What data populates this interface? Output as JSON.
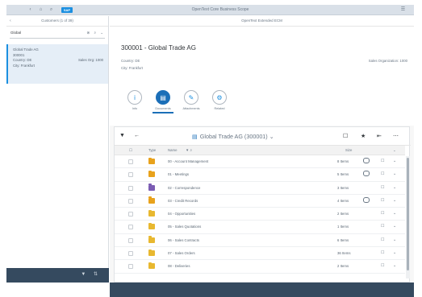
{
  "shell": {
    "title": "OpenText Core Business Scope",
    "logo": "SAP",
    "icons": [
      "back-icon",
      "home-icon",
      "search-icon",
      "user-icon"
    ]
  },
  "master": {
    "header": "Customers (1 of 39)",
    "search_value": "Global",
    "selected_item": {
      "line1": "Global Trade AG",
      "line2": "300001",
      "line3": "Country: DE",
      "line3_right": "Sales Org: 1000",
      "line4": "City: Frankfurt"
    },
    "footer_icons": [
      "filter-icon",
      "sort-icon"
    ]
  },
  "detail": {
    "header": "OpenText Extended ECM",
    "object_title": "300001 - Global Trade AG",
    "attr_country": "Country: DE",
    "attr_city": "City: Frankfurt",
    "attr_sales_org": "Sales Organization: 1000",
    "tabs": [
      {
        "label": "Info",
        "icon": "info-icon",
        "glyph": "i",
        "selected": false
      },
      {
        "label": "Documents",
        "icon": "folder-icon",
        "glyph": "▤",
        "selected": true
      },
      {
        "label": "Attachments",
        "icon": "paperclip-icon",
        "glyph": "✎",
        "selected": false
      },
      {
        "label": "Related",
        "icon": "gear-icon",
        "glyph": "⚙",
        "selected": false
      }
    ],
    "breadcrumb": "Global Trade AG (300001)",
    "columns": {
      "type": "Type",
      "name": "Name",
      "size": "Size"
    },
    "rows": [
      {
        "name": "00 - Account Management",
        "size": "8 Items",
        "color": "#e8a21c",
        "comment": true
      },
      {
        "name": "01 - Meetings",
        "size": "5 Items",
        "color": "#e8a21c",
        "comment": true
      },
      {
        "name": "02 - Correspondence",
        "size": "3 Items",
        "color": "#7b5cb3",
        "comment": false
      },
      {
        "name": "03 - Credit Records",
        "size": "4 Items",
        "color": "#e8a21c",
        "comment": true
      },
      {
        "name": "04 - Opportunities",
        "size": "2 Items",
        "color": "#e8b830",
        "comment": false
      },
      {
        "name": "05 - Sales Quotations",
        "size": "1 Items",
        "color": "#e8b830",
        "comment": false
      },
      {
        "name": "06 - Sales Contracts",
        "size": "6 Items",
        "color": "#e8b830",
        "comment": false
      },
      {
        "name": "07 - Sales Orders",
        "size": "36 Items",
        "color": "#e8b830",
        "comment": false
      },
      {
        "name": "08 - Deliveries",
        "size": "2 Items",
        "color": "#e8b830",
        "comment": false
      }
    ]
  }
}
